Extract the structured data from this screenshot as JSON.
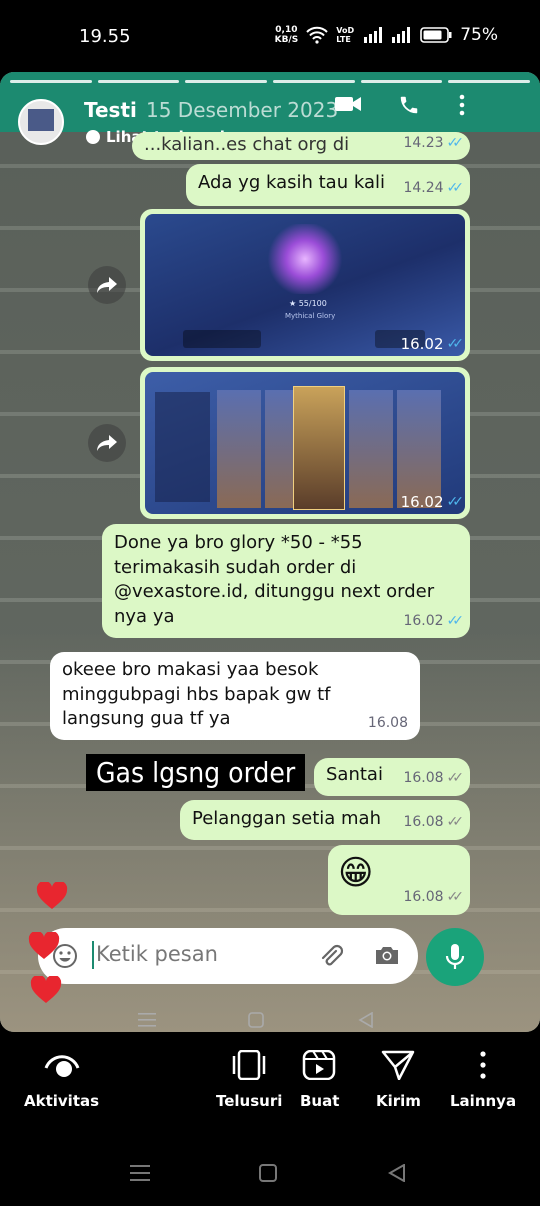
{
  "status": {
    "time": "19.55",
    "net_speed": "0,10",
    "net_unit": "KB/S",
    "volte": "VoD LTE",
    "battery": "75%"
  },
  "chat": {
    "name": "Testi",
    "date": "15 Desember 2023",
    "translate_label": "Lihat terjemahan",
    "messages": [
      {
        "text": "...kalian..es chat org di",
        "time": "14.23"
      },
      {
        "text": "Ada yg kasih tau kali",
        "time": "14.24"
      },
      {
        "time": "16.02"
      },
      {
        "time": "16.02"
      },
      {
        "text": "Done ya bro glory *50 - *55 terimakasih sudah order di @vexastore.id, ditunggu next order nya ya",
        "time": "16.02"
      },
      {
        "text": "okeee bro makasi yaa besok minggubpagi hbs bapak gw tf langsung gua tf ya",
        "time": "16.08"
      },
      {
        "text": "Santai",
        "time": "16.08"
      },
      {
        "text": "Pelanggan setia mah",
        "time": "16.08"
      },
      {
        "text": "😁",
        "time": "16.08"
      }
    ],
    "img1": {
      "stars": "★ 55/100",
      "rank": "Mythical Glory"
    },
    "overlay_text": "Gas lgsng order",
    "input_placeholder": "Ketik pesan"
  },
  "bottom_nav": {
    "items": [
      {
        "label": "Aktivitas",
        "icon": "eye-icon"
      },
      {
        "label": "Telusuri",
        "icon": "phone-frame-icon"
      },
      {
        "label": "Buat",
        "icon": "reel-icon"
      },
      {
        "label": "Kirim",
        "icon": "send-icon"
      },
      {
        "label": "Lainnya",
        "icon": "more-vert-icon"
      }
    ]
  },
  "colors": {
    "header_green": "#1c8a70",
    "bubble_out": "#dcf8c6",
    "tick_blue": "#4fb6ec",
    "mic_green": "#1aa37a",
    "heart_red": "#e8262f"
  }
}
